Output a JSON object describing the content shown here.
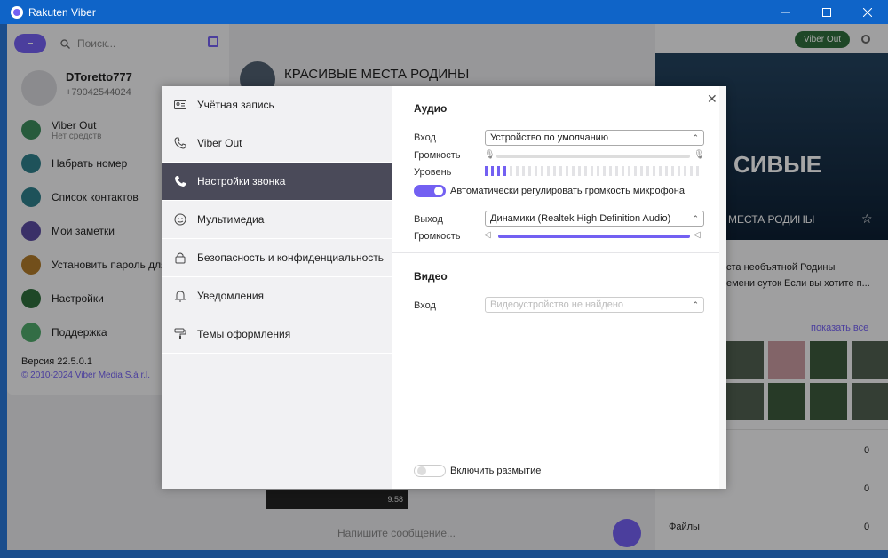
{
  "window": {
    "title": "Rakuten Viber"
  },
  "left": {
    "search_placeholder": "Поиск...",
    "profile_name": "DToretto777",
    "profile_phone": "+79042544024",
    "menu": [
      {
        "label": "Viber Out",
        "sub": "Нет средств"
      },
      {
        "label": "Набрать номер"
      },
      {
        "label": "Список контактов"
      },
      {
        "label": "Мои заметки"
      },
      {
        "label": "Установить пароль для Viber"
      },
      {
        "label": "Настройки"
      },
      {
        "label": "Поддержка"
      }
    ],
    "version": "Версия 22.5.0.1",
    "copyright": "© 2010-2024 Viber Media S.à r.l."
  },
  "chat": {
    "title": "КРАСИВЫЕ МЕСТА РОДИНЫ",
    "composer_placeholder": "Напишите сообщение...",
    "video_time": "9:58"
  },
  "right": {
    "viber_out": "Viber Out",
    "cover_big": "СИВЫЕ",
    "cover_sub": "МЕСТА РОДИНЫ",
    "desc_line1": "ста необъятной Родины",
    "desc_line2": "емени суток Если вы хотите п...",
    "show_all": "показать все",
    "counts": [
      "0",
      "0",
      "0"
    ],
    "files_label": "Файлы"
  },
  "modal": {
    "nav": [
      {
        "label": "Учётная запись",
        "icon": "id-card-icon"
      },
      {
        "label": "Viber Out",
        "icon": "phone-icon"
      },
      {
        "label": "Настройки звонка",
        "icon": "phone-call-icon"
      },
      {
        "label": "Мультимедиа",
        "icon": "media-icon"
      },
      {
        "label": "Безопасность и конфиденциальность",
        "icon": "lock-icon"
      },
      {
        "label": "Уведомления",
        "icon": "bell-icon"
      },
      {
        "label": "Темы оформления",
        "icon": "paint-roller-icon"
      }
    ],
    "audio": {
      "title": "Аудио",
      "input_label": "Вход",
      "input_value": "Устройство по умолчанию",
      "volume_label": "Громкость",
      "level_label": "Уровень",
      "auto_gain_label": "Автоматически регулировать громкость микрофона",
      "auto_gain_on": true,
      "output_label": "Выход",
      "output_value": "Динамики (Realtek High Definition Audio)",
      "output_volume_label": "Громкость",
      "output_volume": 1.0
    },
    "video": {
      "title": "Видео",
      "input_label": "Вход",
      "input_value": "Видеоустройство не найдено",
      "blur_label": "Включить размытие",
      "blur_on": false
    }
  },
  "colors": {
    "accent": "#7360f2",
    "titlebar": "#0f64c8",
    "nav_active": "#4a4a59"
  }
}
